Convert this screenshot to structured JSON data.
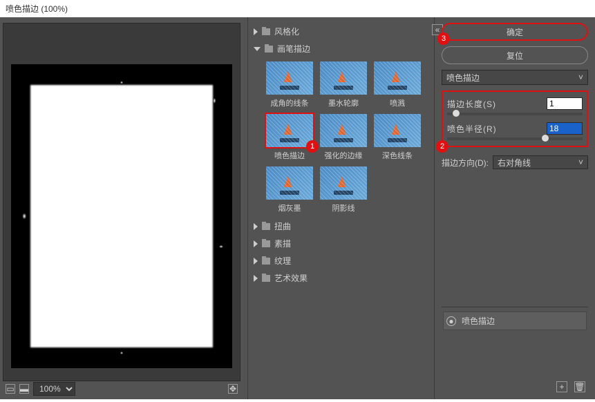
{
  "window": {
    "title": "喷色描边 (100%)"
  },
  "preview": {
    "zoom": "100%"
  },
  "categories": [
    {
      "label": "风格化",
      "open": false
    },
    {
      "label": "画笔描边",
      "open": true
    },
    {
      "label": "扭曲",
      "open": false
    },
    {
      "label": "素描",
      "open": false
    },
    {
      "label": "纹理",
      "open": false
    },
    {
      "label": "艺术效果",
      "open": false
    }
  ],
  "brush_thumbs": [
    {
      "cap": "成角的线条"
    },
    {
      "cap": "墨水轮廓"
    },
    {
      "cap": "喷溅"
    },
    {
      "cap": "喷色描边",
      "selected": true,
      "badge": "1"
    },
    {
      "cap": "强化的边缘"
    },
    {
      "cap": "深色线条"
    },
    {
      "cap": "烟灰墨"
    },
    {
      "cap": "阴影线"
    }
  ],
  "panel": {
    "ok": "确定",
    "ok_badge": "3",
    "reset": "复位",
    "filter_dropdown": "喷色描边",
    "params_badge": "2",
    "stroke_len": {
      "label": "描边长度(S)",
      "value": "1"
    },
    "spray_radius": {
      "label": "喷色半径(R)",
      "value": "18"
    },
    "direction": {
      "label": "描边方向(D):",
      "value": "右对角线"
    },
    "layer_name": "喷色描边"
  }
}
